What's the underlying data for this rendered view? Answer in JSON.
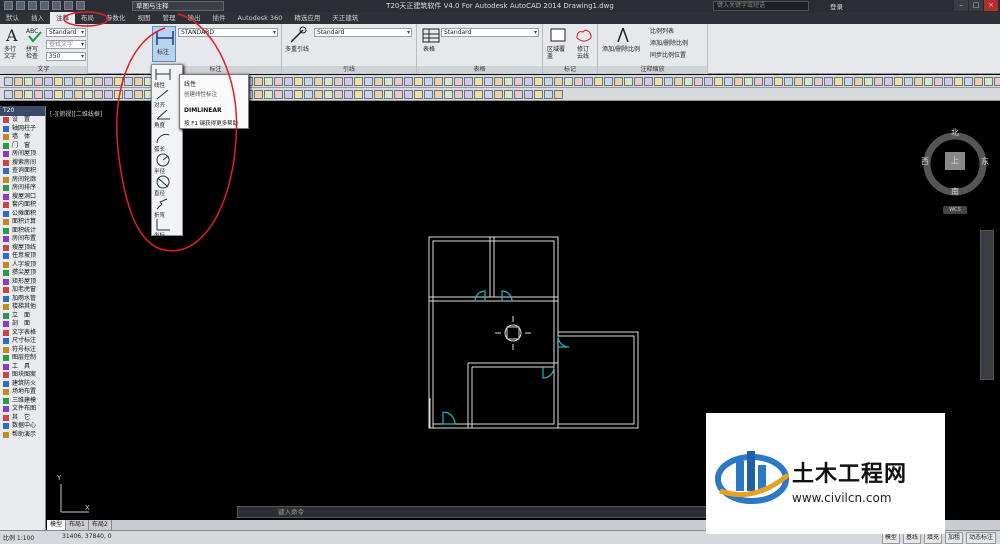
{
  "window": {
    "title": "T20天正建筑软件 V4.0 For Autodesk AutoCAD 2014    Drawing1.dwg",
    "workspace": "草图与注释",
    "search_placeholder": "键入关键字或短语",
    "login": "登录"
  },
  "menu": [
    "默认",
    "插入",
    "注释",
    "布局",
    "参数化",
    "视图",
    "管理",
    "输出",
    "插件",
    "Autodesk 360",
    "精选应用",
    "天正建筑"
  ],
  "ribbon": {
    "text_panel": {
      "label": "文字",
      "big1": "多行文字",
      "big2": "拼写检查",
      "style": "Standard",
      "find": "查找文字",
      "height": "350"
    },
    "dim_panel": {
      "label": "标注",
      "big": "标注",
      "style": "STANDARD"
    },
    "leader_panel": {
      "label": "引线",
      "big": "多重引线",
      "style": "Standard"
    },
    "table_panel": {
      "label": "表格",
      "big": "表格",
      "style": "Standard"
    },
    "mark_panel": {
      "label": "标记",
      "b1": "区域覆盖",
      "b2": "修订云线"
    },
    "scale_panel": {
      "label": "注释缩放",
      "big": "添加/删除比例",
      "s1": "比例列表",
      "s2": "添加/删除比例",
      "s3": "同步比例位置"
    }
  },
  "dim_dropdown": [
    "线性",
    "对齐",
    "角度",
    "弧长",
    "半径",
    "直径",
    "折弯",
    "坐标"
  ],
  "tooltip": {
    "title": "线性",
    "desc": "创建线性标注",
    "cmd": "DIMLINEAR",
    "help": "按 F1 键获得更多帮助"
  },
  "palette": {
    "header": "T20",
    "items": [
      "设　置",
      "轴网柱子",
      "墙　体",
      "门　窗",
      "房间屋顶",
      "搜索房间",
      "查询面积",
      "房间轮廓",
      "房间排序",
      "搜屋洞口",
      "套内面积",
      "公摊面积",
      "面积计算",
      "面积统计",
      "房间布置",
      "搜屋顶线",
      "任意坡顶",
      "人字坡顶",
      "攒尖屋顶",
      "矩形屋顶",
      "加老虎窗",
      "加雨水管",
      "楼梯其他",
      "立　面",
      "剖　面",
      "文字表格",
      "尺寸标注",
      "符号标注",
      "图层控制",
      "工　具",
      "图块图案",
      "建筑防火",
      "场地布置",
      "三维建模",
      "文件布图",
      "其　它",
      "数据中心",
      "帮助演示"
    ]
  },
  "viewport_label": "[-][俯视][二维线框]",
  "compass": {
    "n": "北",
    "s": "南",
    "w": "西",
    "e": "东",
    "top": "上",
    "wcs": "WCS"
  },
  "command_placeholder": "键入命令",
  "layout_tabs": [
    "模型",
    "布局1",
    "布局2"
  ],
  "status": {
    "scale": "比例 1:100",
    "coords": "31406, 37840, 0",
    "right": [
      "模型",
      "基线",
      "填充",
      "加粗",
      "动态标注"
    ]
  },
  "watermark": {
    "cn": "土木工程网",
    "url": "www.civilcn.com"
  },
  "colors": {
    "accent": "#1fb6c4",
    "annot": "#e02020",
    "wall": "#dcdcdc"
  }
}
